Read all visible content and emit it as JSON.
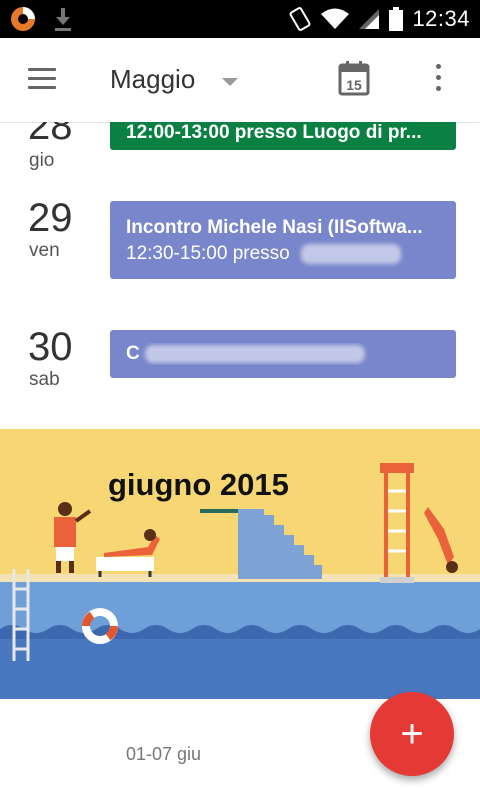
{
  "status_bar": {
    "time": "12:34"
  },
  "toolbar": {
    "month": "Maggio",
    "today_day": "15"
  },
  "agenda": {
    "days": [
      {
        "number": "28",
        "name": "gio",
        "events": [
          {
            "title": "",
            "subtitle": "12:00-13:00 presso Luogo di pr...",
            "color": "#0b8043"
          }
        ]
      },
      {
        "number": "29",
        "name": "ven",
        "events": [
          {
            "title": "Incontro Michele Nasi (IlSoftwa...",
            "subtitle": "12:30-15:00 presso",
            "color": "#7986cb"
          }
        ]
      },
      {
        "number": "30",
        "name": "sab",
        "events": [
          {
            "title": "C",
            "subtitle": "",
            "color": "#7986cb"
          }
        ]
      }
    ]
  },
  "month_banner": {
    "title": "giugno 2015",
    "background": "#f6d774",
    "water": "#6fa0da"
  },
  "week": {
    "label": "01-07 giu"
  },
  "fab": {
    "label": "+",
    "color": "#e53935"
  }
}
